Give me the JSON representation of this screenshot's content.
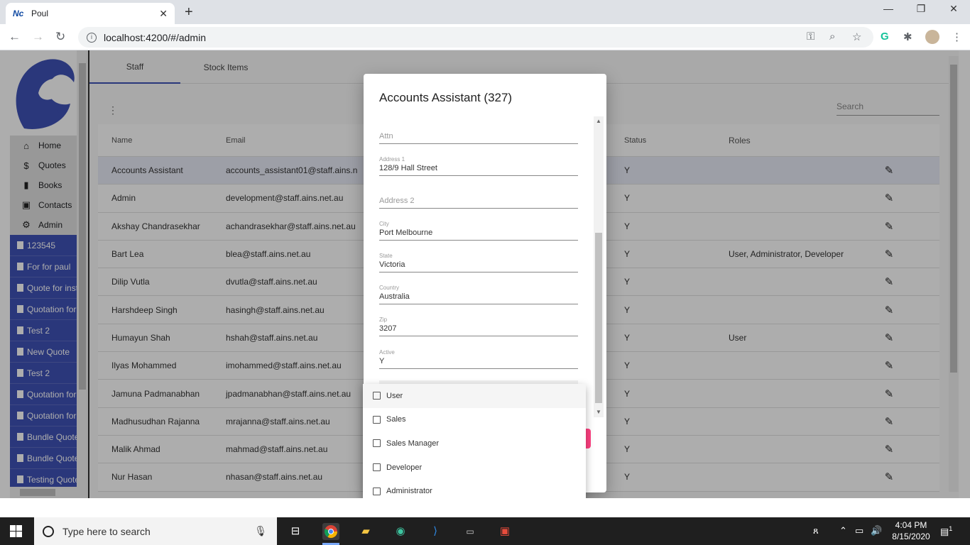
{
  "browser": {
    "tab_title": "Poul",
    "tab_favicon": "Nc",
    "url": "localhost:4200/#/admin"
  },
  "sidebar": {
    "nav": [
      {
        "label": "Home",
        "icon": "home-icon",
        "glyph": "⌂"
      },
      {
        "label": "Quotes",
        "icon": "quote-icon",
        "glyph": "$"
      },
      {
        "label": "Books",
        "icon": "book-icon",
        "glyph": "▮"
      },
      {
        "label": "Contacts",
        "icon": "contact-icon",
        "glyph": "▣"
      },
      {
        "label": "Admin",
        "icon": "gear-icon",
        "glyph": "⚙"
      }
    ],
    "docs": [
      "123545",
      "For for paul",
      "Quote for insta",
      "Quotation for c",
      "Test 2",
      "New Quote",
      "Test 2",
      "Quotation for c",
      "Quotation for c",
      "Bundle Quote",
      "Bundle Quote",
      "Testing Quote"
    ]
  },
  "main": {
    "tabs": [
      "Staff",
      "Stock Items"
    ],
    "search_placeholder": "Search",
    "columns": {
      "name": "Name",
      "email": "Email",
      "status": "Status",
      "roles": "Roles"
    },
    "rows": [
      {
        "name": "Accounts Assistant",
        "email": "accounts_assistant01@staff.ains.n",
        "status": "Y",
        "roles": ""
      },
      {
        "name": "Admin",
        "email": "development@staff.ains.net.au",
        "status": "Y",
        "roles": ""
      },
      {
        "name": "Akshay Chandrasekhar",
        "email": "achandrasekhar@staff.ains.net.au",
        "status": "Y",
        "roles": ""
      },
      {
        "name": "Bart Lea",
        "email": "blea@staff.ains.net.au",
        "status": "Y",
        "roles": "User, Administrator, Developer"
      },
      {
        "name": "Dilip Vutla",
        "email": "dvutla@staff.ains.net.au",
        "status": "Y",
        "roles": ""
      },
      {
        "name": "Harshdeep Singh",
        "email": "hasingh@staff.ains.net.au",
        "status": "Y",
        "roles": ""
      },
      {
        "name": "Humayun Shah",
        "email": "hshah@staff.ains.net.au",
        "status": "Y",
        "roles": "User"
      },
      {
        "name": "Ilyas Mohammed",
        "email": "imohammed@staff.ains.net.au",
        "status": "Y",
        "roles": ""
      },
      {
        "name": "Jamuna Padmanabhan",
        "email": "jpadmanabhan@staff.ains.net.au",
        "status": "Y",
        "roles": ""
      },
      {
        "name": "Madhusudhan Rajanna",
        "email": "mrajanna@staff.ains.net.au",
        "status": "Y",
        "roles": ""
      },
      {
        "name": "Malik Ahmad",
        "email": "mahmad@staff.ains.net.au",
        "status": "Y",
        "roles": ""
      },
      {
        "name": "Nur Hasan",
        "email": "nhasan@staff.ains.net.au",
        "status": "Y",
        "roles": ""
      }
    ]
  },
  "dialog": {
    "title": "Accounts Assistant (327)",
    "attn_placeholder": "Attn",
    "address1_label": "Address 1",
    "address1_value": "128/9 Hall Street",
    "address2_placeholder": "Address 2",
    "city_label": "City",
    "city_value": "Port Melbourne",
    "state_label": "State",
    "state_value": "Victoria",
    "country_label": "Country",
    "country_value": "Australia",
    "zip_label": "Zip",
    "zip_value": "3207",
    "active_label": "Active",
    "active_value": "Y",
    "accent_color": "#ff4081"
  },
  "roles_dropdown": {
    "options": [
      "User",
      "Sales",
      "Sales Manager",
      "Developer",
      "Administrator"
    ]
  },
  "taskbar": {
    "search_placeholder": "Type here to search",
    "time": "4:04 PM",
    "date": "8/15/2020",
    "notification_count": "1"
  }
}
